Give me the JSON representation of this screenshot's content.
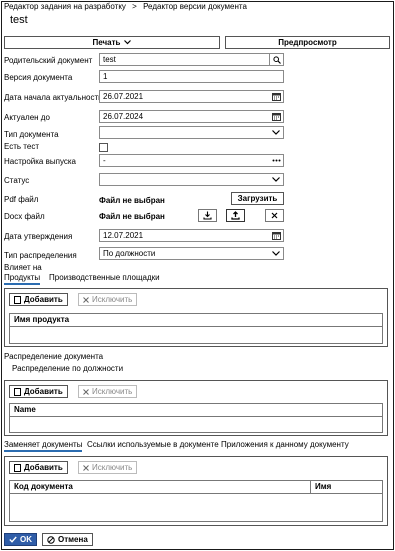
{
  "breadcrumb": {
    "parent": "Редактор задания на разработку",
    "separator": ">",
    "current": "Редактор версии документа"
  },
  "title": "test",
  "toolbar": {
    "print_label": "Печать",
    "preview_label": "Предпросмотр"
  },
  "form": {
    "parent_doc_label": "Родительский документ",
    "parent_doc_value": "test",
    "version_label": "Версия документа",
    "version_value": "1",
    "start_date_label": "Дата начала актуальности",
    "start_date_value": "26.07.2021",
    "actual_to_label": "Актуален до",
    "actual_to_value": "26.07.2024",
    "doc_type_label": "Тип документа",
    "doc_type_value": "",
    "has_test_label": "Есть тест",
    "has_test_checked": false,
    "release_label": "Настройка выпуска",
    "release_value": "-",
    "status_label": "Статус",
    "status_value": "",
    "pdf_label": "Pdf файл",
    "pdf_value": "Файл не выбран",
    "upload_label": "Загрузить",
    "docx_label": "Docx файл",
    "docx_value": "Файл не выбран",
    "approve_date_label": "Дата утверждения",
    "approve_date_value": "12.07.2021",
    "dist_type_label": "Тип распределения",
    "dist_type_value": "По должности",
    "affects_label": "Влияет на"
  },
  "tabs_affects": [
    {
      "label": "Продукты",
      "active": true
    },
    {
      "label": "Производственные площадки",
      "active": false
    }
  ],
  "products_panel": {
    "add_label": "Добавить",
    "exclude_label": "Исключить",
    "column": "Имя продукта"
  },
  "distribution": {
    "section_label": "Распределение документа",
    "tab_label": "Распределение по должности",
    "add_label": "Добавить",
    "exclude_label": "Исключить",
    "column": "Name"
  },
  "tabs_bottom": [
    {
      "label": "Заменяет документы",
      "active": true
    },
    {
      "label": "Ссылки используемые в документе",
      "active": false
    },
    {
      "label": "Приложения к данному документу",
      "active": false
    }
  ],
  "replaces_panel": {
    "add_label": "Добавить",
    "exclude_label": "Исключить",
    "columns": [
      "Код документа",
      "Имя"
    ]
  },
  "footer": {
    "ok_label": "OK",
    "cancel_label": "Отмена"
  },
  "colors": {
    "accent": "#2f5da8",
    "tab_underline": "#2b6cb0"
  }
}
